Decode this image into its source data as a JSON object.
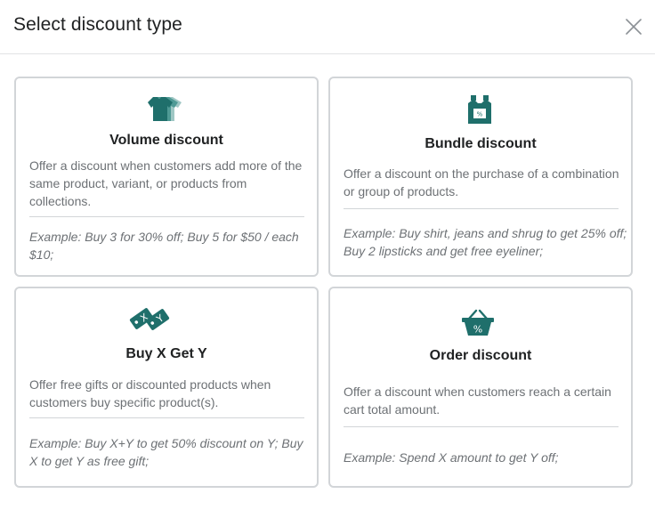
{
  "dialog": {
    "title": "Select discount type",
    "close_icon": "close-icon"
  },
  "colors": {
    "icon_teal": "#1f6f6b",
    "border": "#d2d5d8",
    "muted_text": "#6d7175"
  },
  "cards": [
    {
      "icon": "tshirt-icon",
      "title": "Volume discount",
      "description": "Offer a discount when customers add more of the same product, variant, or products from collections.",
      "example": "Example: Buy 3 for 30% off; Buy 5 for $50 / each $10;"
    },
    {
      "icon": "bottles-icon",
      "title": "Bundle discount",
      "description": "Offer a discount on the purchase of a combination or group of products.",
      "example": "Example: Buy shirt, jeans and shrug to get 25% off; Buy 2 lipsticks and get free eyeliner;"
    },
    {
      "icon": "xy-tags-icon",
      "title": "Buy X Get Y",
      "description": "Offer free gifts or discounted products when customers buy specific product(s).",
      "example": "Example: Buy X+Y to get 50% discount on Y; Buy X to get Y as free gift;"
    },
    {
      "icon": "basket-percent-icon",
      "title": "Order discount",
      "description": "Offer a discount when customers reach a certain cart total amount.",
      "example": "Example: Spend X amount to get Y off;"
    }
  ]
}
